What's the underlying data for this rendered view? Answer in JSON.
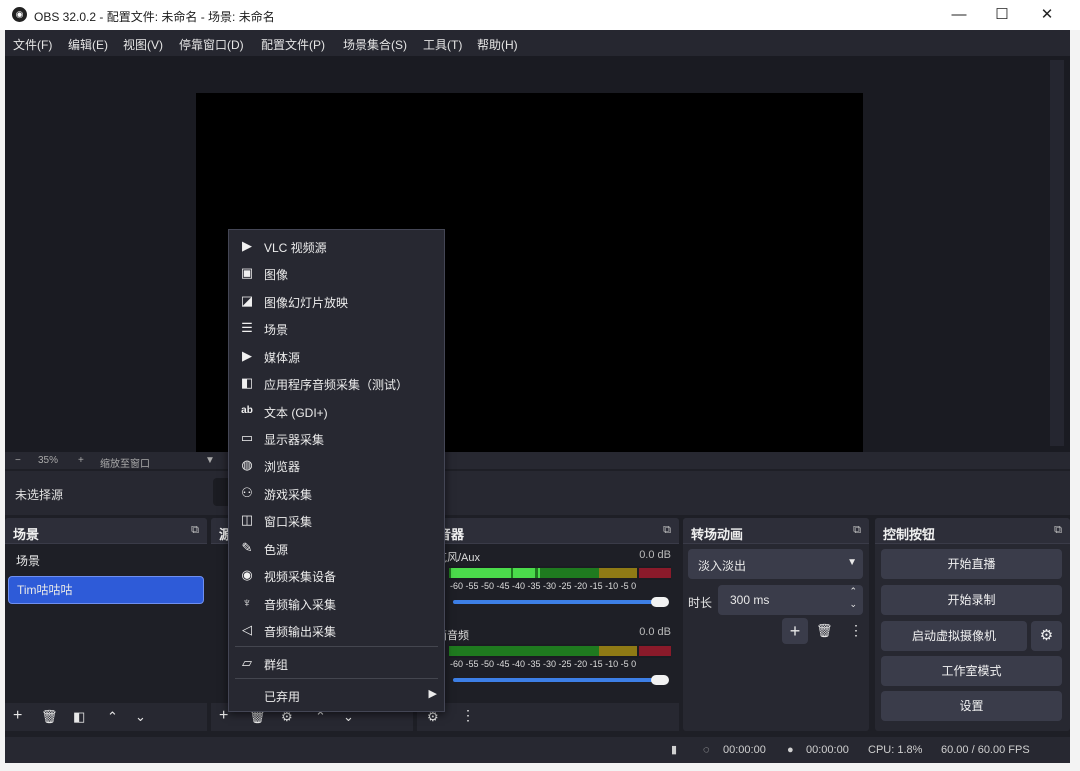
{
  "window": {
    "title": "OBS 32.0.2 - 配置文件: 未命名 - 场景: 未命名",
    "minimize": "—",
    "maximize": "☐",
    "close": "✕"
  },
  "menubar": [
    "文件(F)",
    "编辑(E)",
    "视图(V)",
    "停靠窗口(D)",
    "配置文件(P)",
    "场景集合(S)",
    "工具(T)",
    "帮助(H)"
  ],
  "zoom": {
    "minus": "−",
    "value": "35%",
    "plus": "+",
    "mode": "缩放至窗口",
    "arrow": "▼"
  },
  "source_bar": {
    "no_source": "未选择源"
  },
  "scenes": {
    "title": "场景",
    "items": [
      "场景",
      "Tim咕咕咕"
    ],
    "selected": "Tim咕咕咕"
  },
  "sources": {
    "title": "源"
  },
  "mixer": {
    "title": "混音器",
    "channels": [
      {
        "name": "麦克风/Aux",
        "db": "0.0 dB",
        "level": 0.62,
        "volume": 1.0
      },
      {
        "name": "桌面音频",
        "db": "0.0 dB",
        "level": 0.0,
        "volume": 1.0
      }
    ],
    "scale": "-60 -55 -50 -45 -40 -35 -30 -25 -20 -15 -10 -5 0"
  },
  "transitions": {
    "title": "转场动画",
    "selected": "淡入淡出",
    "duration_label": "时长",
    "duration_value": "300 ms"
  },
  "controls": {
    "title": "控制按钮",
    "start_stream": "开始直播",
    "start_record": "开始录制",
    "virtual_cam": "启动虚拟摄像机",
    "studio_mode": "工作室模式",
    "settings": "设置"
  },
  "context_menu": {
    "items": [
      {
        "icon": "play-icon",
        "glyph": "▶",
        "label": "VLC 视频源"
      },
      {
        "icon": "image-icon",
        "glyph": "▣",
        "label": "图像"
      },
      {
        "icon": "slideshow-icon",
        "glyph": "◪",
        "label": "图像幻灯片放映"
      },
      {
        "icon": "list-icon",
        "glyph": "☰",
        "label": "场景"
      },
      {
        "icon": "play-icon",
        "glyph": "▶",
        "label": "媒体源"
      },
      {
        "icon": "app-audio-icon",
        "glyph": "◧",
        "label": "应用程序音频采集（测试）"
      },
      {
        "icon": "text-icon",
        "glyph": "ab",
        "label": "文本 (GDI+)"
      },
      {
        "icon": "monitor-icon",
        "glyph": "▭",
        "label": "显示器采集"
      },
      {
        "icon": "globe-icon",
        "glyph": "◍",
        "label": "浏览器"
      },
      {
        "icon": "gamepad-icon",
        "glyph": "⚇",
        "label": "游戏采集"
      },
      {
        "icon": "window-icon",
        "glyph": "◫",
        "label": "窗口采集"
      },
      {
        "icon": "brush-icon",
        "glyph": "✎",
        "label": "色源"
      },
      {
        "icon": "camera-icon",
        "glyph": "◉",
        "label": "视频采集设备"
      },
      {
        "icon": "microphone-icon",
        "glyph": "♆",
        "label": "音频输入采集"
      },
      {
        "icon": "speaker-icon",
        "glyph": "◁",
        "label": "音频输出采集"
      }
    ],
    "group": {
      "icon": "folder-icon",
      "glyph": "▱",
      "label": "群组"
    },
    "deprecated": {
      "label": "已弃用",
      "arrow": "▶"
    }
  },
  "status": {
    "rec_time": "00:00:00",
    "stream_time": "00:00:00",
    "cpu": "CPU: 1.8%",
    "fps": "60.00 / 60.00 FPS"
  },
  "colors": {
    "accent": "#2e5bd8",
    "panel": "#272831",
    "background": "#1e1f26"
  }
}
